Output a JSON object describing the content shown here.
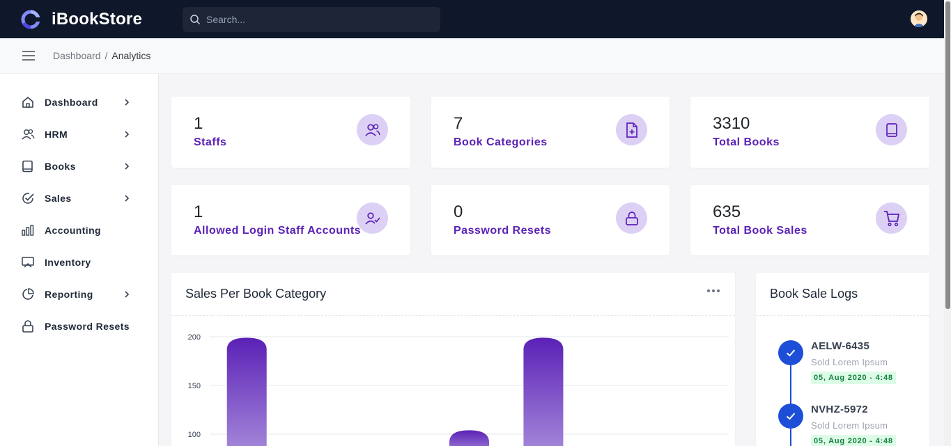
{
  "app": {
    "name": "iBookStore"
  },
  "search": {
    "placeholder": "Search..."
  },
  "breadcrumb": {
    "root": "Dashboard",
    "separator": "/",
    "current": "Analytics"
  },
  "sidebar": {
    "items": [
      {
        "label": "Dashboard",
        "icon": "home-icon",
        "has_children": true
      },
      {
        "label": "HRM",
        "icon": "users-icon",
        "has_children": true
      },
      {
        "label": "Books",
        "icon": "book-icon",
        "has_children": true
      },
      {
        "label": "Sales",
        "icon": "check-circle-icon",
        "has_children": true
      },
      {
        "label": "Accounting",
        "icon": "bar-chart-icon",
        "has_children": false
      },
      {
        "label": "Inventory",
        "icon": "monitor-icon",
        "has_children": false
      },
      {
        "label": "Reporting",
        "icon": "pie-chart-icon",
        "has_children": true
      },
      {
        "label": "Password Resets",
        "icon": "lock-icon",
        "has_children": false
      }
    ]
  },
  "stats": [
    {
      "value": "1",
      "label": "Staffs",
      "icon": "users-icon"
    },
    {
      "value": "7",
      "label": "Book Categories",
      "icon": "file-plus-icon"
    },
    {
      "value": "3310",
      "label": "Total Books",
      "icon": "book-icon"
    },
    {
      "value": "1",
      "label": "Allowed Login Staff Accounts",
      "icon": "user-check-icon"
    },
    {
      "value": "0",
      "label": "Password Resets",
      "icon": "lock-icon"
    },
    {
      "value": "635",
      "label": "Total Book Sales",
      "icon": "cart-icon"
    }
  ],
  "chart_panel": {
    "title": "Sales Per Book Category"
  },
  "chart_data": {
    "type": "bar",
    "title": "Sales Per Book Category",
    "xlabel": "",
    "ylabel": "",
    "y_ticks": [
      100,
      150,
      200
    ],
    "ylim_visible": [
      100,
      200
    ],
    "values": [
      199,
      null,
      null,
      104,
      199
    ],
    "grid": true,
    "colors": {
      "bar_top": "#5b21b6",
      "bar_bottom": "#a78bdb"
    }
  },
  "logs_panel": {
    "title": "Book Sale Logs"
  },
  "logs": [
    {
      "code": "AELW-6435",
      "desc": "Sold Lorem Ipsum",
      "date": "05, Aug 2020 - 4:48"
    },
    {
      "code": "NVHZ-5972",
      "desc": "Sold Lorem Ipsum",
      "date": "05, Aug 2020 - 4:48"
    }
  ],
  "colors": {
    "accent": "#5b21b6",
    "topbar": "#0f172a",
    "icon_bg": "#ddd0f5",
    "timeline": "#1d4ed8"
  }
}
